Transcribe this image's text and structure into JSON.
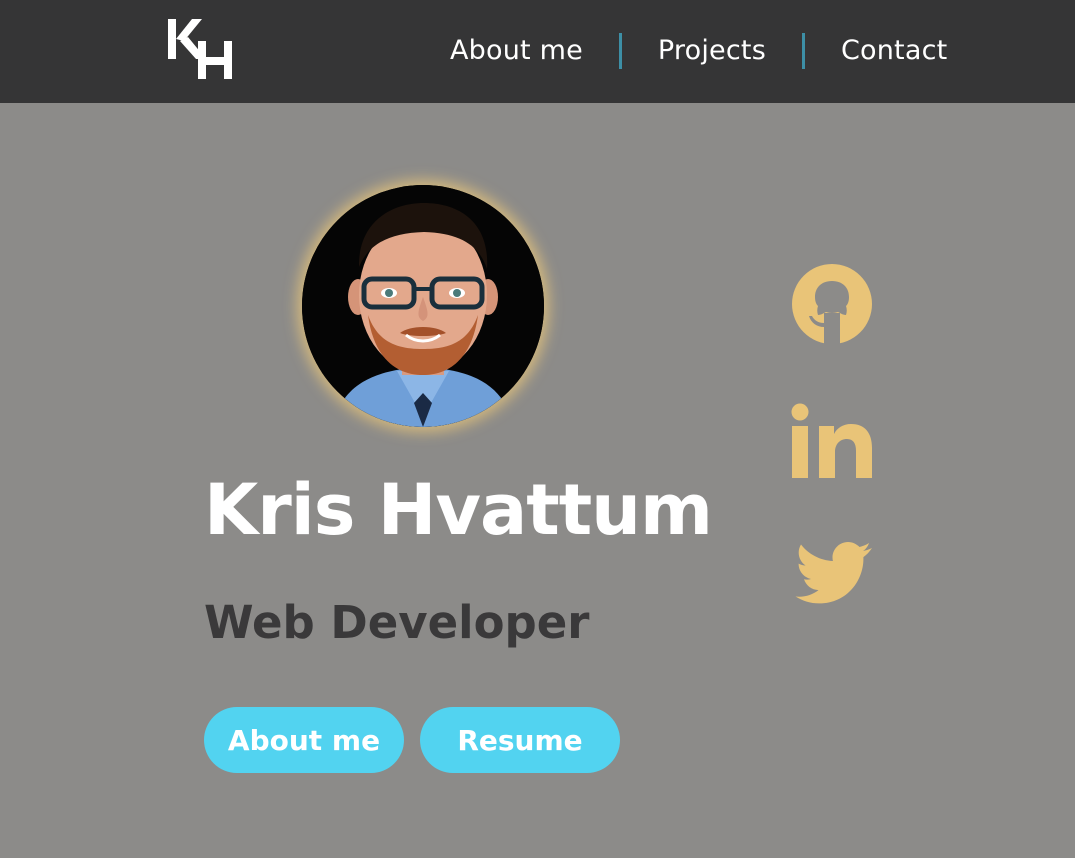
{
  "brand": {
    "logo_text": "KH",
    "logo_alt": "Kris Hvattum logo"
  },
  "nav": {
    "items": [
      {
        "label": "About me"
      },
      {
        "label": "Projects"
      },
      {
        "label": "Contact"
      }
    ]
  },
  "hero": {
    "avatar_alt": "Portrait of Kris Hvattum",
    "name": "Kris Hvattum",
    "role": "Web Developer",
    "buttons": {
      "about_label": "About me",
      "resume_label": "Resume"
    }
  },
  "social": {
    "items": [
      {
        "icon": "github-icon"
      },
      {
        "icon": "linkedin-icon"
      },
      {
        "icon": "twitter-icon"
      }
    ]
  },
  "colors": {
    "page_background": "#8c8b89",
    "navbar_background": "#353536",
    "nav_separator": "#3d8fa6",
    "button_background": "#52d3f0",
    "social_icon": "#e9c478",
    "avatar_glow": "#ecc87a",
    "role_text": "#3a393a"
  }
}
